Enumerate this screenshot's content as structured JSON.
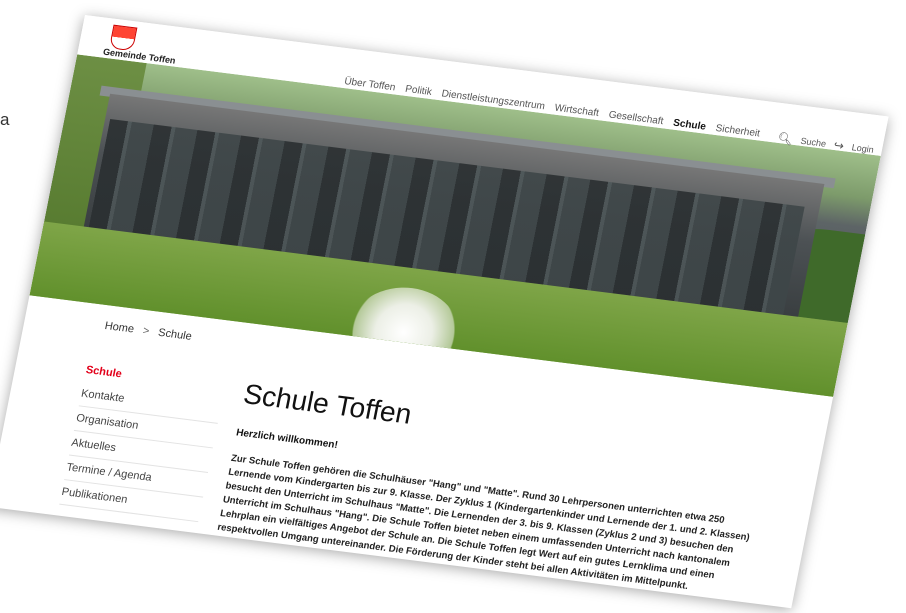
{
  "edge_letter": "a",
  "site": {
    "logo_text": "Gemeinde Toffen"
  },
  "nav": {
    "items": [
      "Über Toffen",
      "Politik",
      "Dienstleistungszentrum",
      "Wirtschaft",
      "Gesellschaft",
      "Schule",
      "Sicherheit"
    ],
    "active": "Schule",
    "search_label": "Suche",
    "login_label": "Login"
  },
  "breadcrumb": {
    "home": "Home",
    "separator": ">",
    "current": "Schule"
  },
  "sidebar": {
    "items": [
      "Schule",
      "Kontakte",
      "Organisation",
      "Aktuelles",
      "Termine / Agenda",
      "Publikationen"
    ]
  },
  "main": {
    "title": "Schule Toffen",
    "welcome": "Herzlich willkommen!",
    "paragraph": "Zur Schule Toffen gehören die Schulhäuser \"Hang\" und \"Matte\". Rund 30 Lehrpersonen unterrichten etwa 250 Lernende vom Kindergarten bis zur 9. Klasse. Der Zyklus 1 (Kindergartenkinder und Lernende der 1. und 2. Klassen) besucht den Unterricht im Schulhaus \"Matte\". Die Lernenden der 3. bis 9. Klassen (Zyklus 2 und 3) besuchen den Unterricht im Schulhaus \"Hang\". Die Schule Toffen bietet neben einem umfassenden Unterricht nach kantonalem Lehrplan ein vielfältiges Angebot der Schule an. Die Schule Toffen legt Wert auf ein gutes Lernklima und einen respektvollen Umgang untereinander. Die Förderung der Kinder steht bei allen Aktivitäten im Mittelpunkt."
  },
  "colors": {
    "accent": "#e2001a",
    "text": "#222222"
  }
}
